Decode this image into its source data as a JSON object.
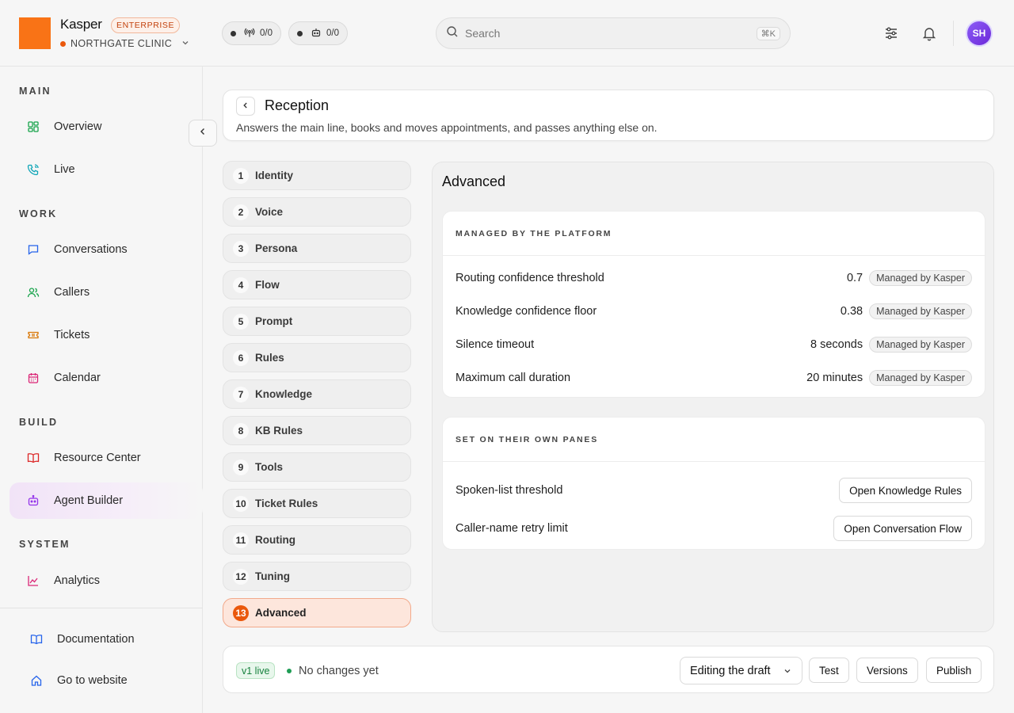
{
  "brand": {
    "name": "Kasper",
    "badge": "ENTERPRISE",
    "org": "NORTHGATE CLINIC"
  },
  "counters": [
    {
      "icon": "broadcast-icon",
      "value": "0/0"
    },
    {
      "icon": "bot-icon",
      "value": "0/0"
    }
  ],
  "search": {
    "placeholder": "Search",
    "shortcut": "⌘K"
  },
  "user": {
    "initials": "SH"
  },
  "sidebar": {
    "sections": [
      "MAIN",
      "WORK",
      "BUILD",
      "SYSTEM"
    ],
    "items": [
      {
        "label": "Overview",
        "icon": "grid-icon"
      },
      {
        "label": "Live",
        "icon": "phone-icon"
      },
      {
        "label": "Conversations",
        "icon": "chat-icon"
      },
      {
        "label": "Callers",
        "icon": "users-icon"
      },
      {
        "label": "Tickets",
        "icon": "ticket-icon"
      },
      {
        "label": "Calendar",
        "icon": "calendar-icon"
      },
      {
        "label": "Resource Center",
        "icon": "book-icon"
      },
      {
        "label": "Agent Builder",
        "icon": "bot-icon"
      },
      {
        "label": "Analytics",
        "icon": "chart-icon"
      }
    ],
    "active": "Agent Builder",
    "footer": [
      {
        "label": "Documentation",
        "icon": "docs-icon"
      },
      {
        "label": "Go to website",
        "icon": "home-icon"
      }
    ]
  },
  "agent": {
    "name": "Reception",
    "description": "Answers the main line, books and moves appointments, and passes anything else on."
  },
  "steps": [
    {
      "num": "1",
      "label": "Identity"
    },
    {
      "num": "2",
      "label": "Voice"
    },
    {
      "num": "3",
      "label": "Persona"
    },
    {
      "num": "4",
      "label": "Flow"
    },
    {
      "num": "5",
      "label": "Prompt"
    },
    {
      "num": "6",
      "label": "Rules"
    },
    {
      "num": "7",
      "label": "Knowledge"
    },
    {
      "num": "8",
      "label": "KB Rules"
    },
    {
      "num": "9",
      "label": "Tools"
    },
    {
      "num": "10",
      "label": "Ticket Rules"
    },
    {
      "num": "11",
      "label": "Routing"
    },
    {
      "num": "12",
      "label": "Tuning"
    },
    {
      "num": "13",
      "label": "Advanced"
    }
  ],
  "active_step": "Advanced",
  "advanced": {
    "title": "Advanced",
    "managed": {
      "heading": "MANAGED BY THE PLATFORM",
      "rows": [
        {
          "label": "Routing confidence threshold",
          "value": "0.7",
          "tag": "Managed by Kasper"
        },
        {
          "label": "Knowledge confidence floor",
          "value": "0.38",
          "tag": "Managed by Kasper"
        },
        {
          "label": "Silence timeout",
          "value": "8 seconds",
          "tag": "Managed by Kasper"
        },
        {
          "label": "Maximum call duration",
          "value": "20 minutes",
          "tag": "Managed by Kasper"
        }
      ]
    },
    "own_panes": {
      "heading": "SET ON THEIR OWN PANES",
      "rows": [
        {
          "label": "Spoken-list threshold",
          "button": "Open Knowledge Rules"
        },
        {
          "label": "Caller-name retry limit",
          "button": "Open Conversation Flow"
        }
      ]
    }
  },
  "footer_bar": {
    "version_badge": "v1 live",
    "status": "No changes yet",
    "mode": "Editing the draft",
    "buttons": [
      "Test",
      "Versions",
      "Publish"
    ]
  },
  "colors": {
    "accent": "#ea580c",
    "brand": "#f97316",
    "active_nav": "#f1e3f7",
    "live_green": "#16813d"
  }
}
